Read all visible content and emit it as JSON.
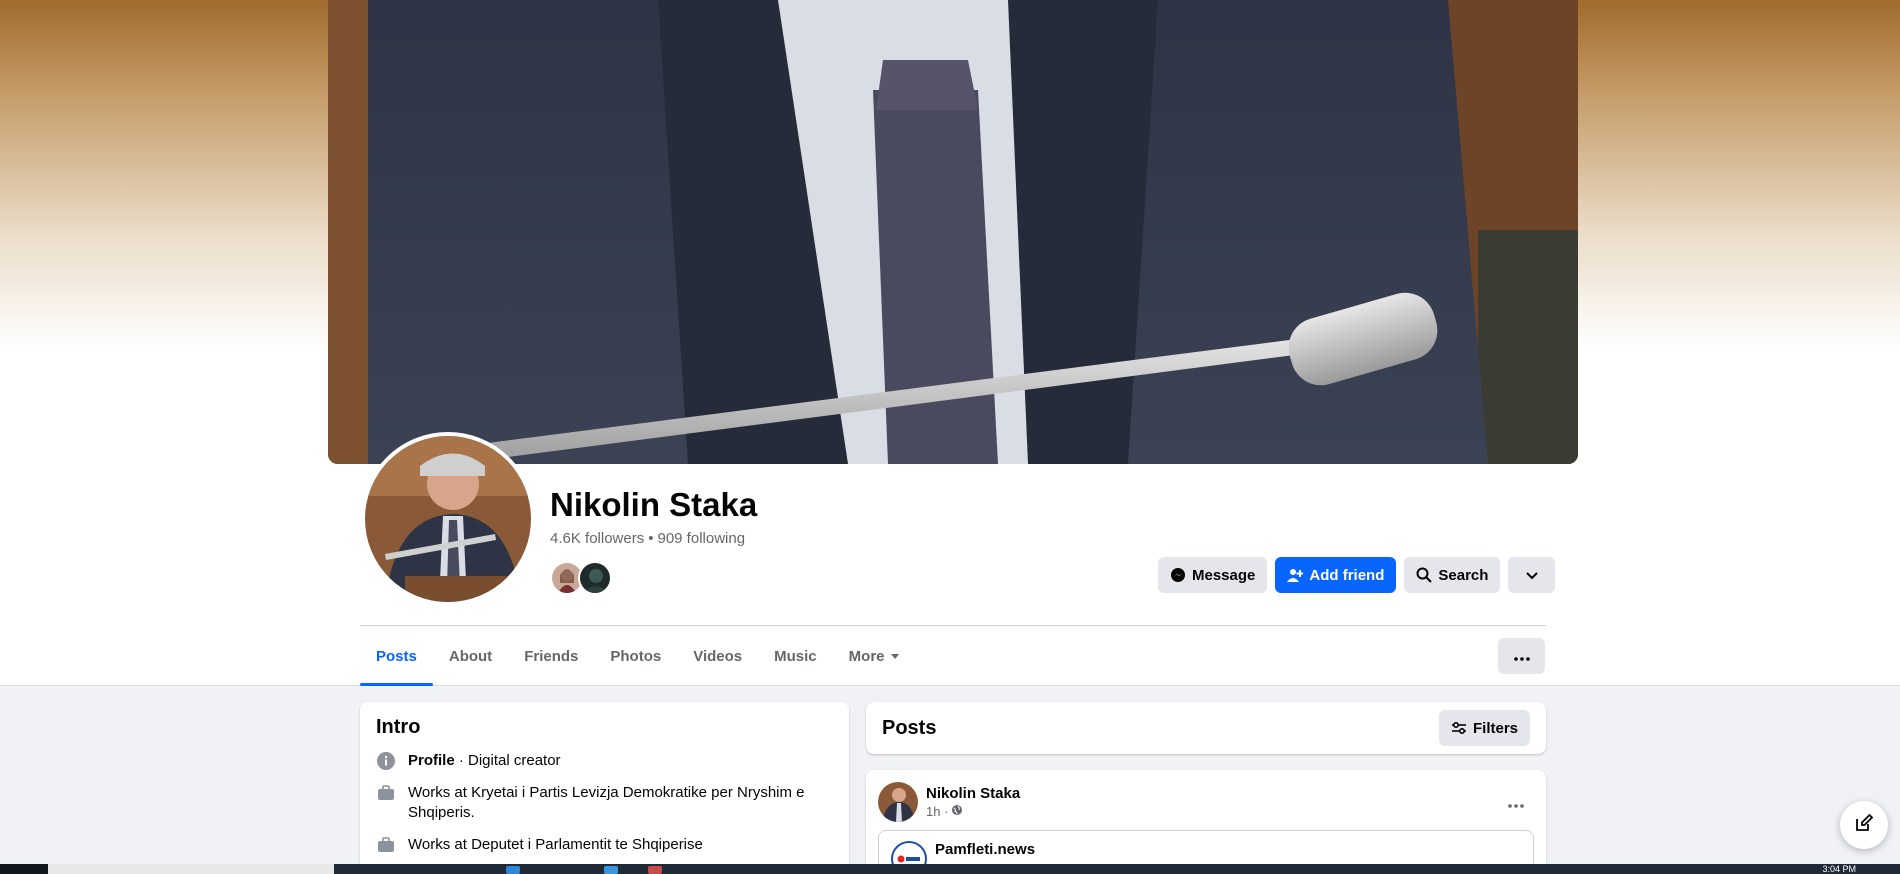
{
  "profile": {
    "name": "Nikolin Staka",
    "followers": "4.6K followers",
    "separator": "•",
    "following": "909 following"
  },
  "actions": {
    "message": "Message",
    "add_friend": "Add friend",
    "search": "Search"
  },
  "tabs": [
    "Posts",
    "About",
    "Friends",
    "Photos",
    "Videos",
    "Music",
    "More"
  ],
  "intro": {
    "title": "Intro",
    "profile_label": "Profile",
    "profile_type": " · Digital creator",
    "work1": "Works at Kryetai i Partis Levizja Demokratike per Nryshim e Shqiperis.",
    "work2": "Works at Deputet i Parlamentit te Shqiperise"
  },
  "posts": {
    "title": "Posts",
    "filters": "Filters",
    "post": {
      "author": "Nikolin Staka",
      "time": "1h ·",
      "shared_source": "Pamfleti.news"
    }
  },
  "taskbar": {
    "clock": "3:04 PM"
  },
  "colors": {
    "accent": "#0866ff",
    "secondary_text": "#65676b",
    "button_bg": "#e4e6eb"
  }
}
